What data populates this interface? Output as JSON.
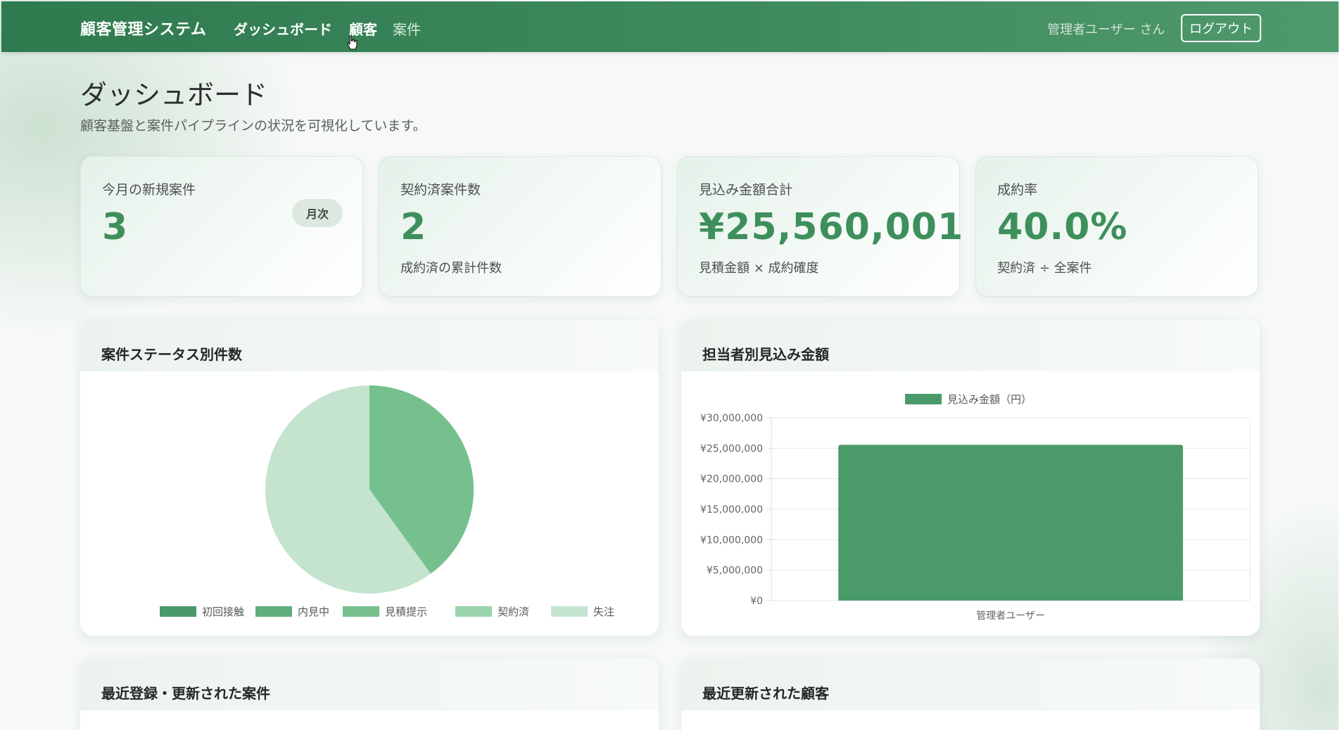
{
  "nav": {
    "brand": "顧客管理システム",
    "links": [
      "ダッシュボード",
      "顧客",
      "案件"
    ],
    "user": "管理者ユーザー さん",
    "logout": "ログアウト"
  },
  "header": {
    "title": "ダッシュボード",
    "subtitle": "顧客基盤と案件パイプラインの状況を可視化しています。"
  },
  "stats": [
    {
      "label": "今月の新規案件",
      "value": "3",
      "badge": "月次",
      "note": ""
    },
    {
      "label": "契約済案件数",
      "value": "2",
      "note": "成約済の累計件数"
    },
    {
      "label": "見込み金額合計",
      "value": "¥25,560,001",
      "note": "見積金額 × 成約確度"
    },
    {
      "label": "成約率",
      "value": "40.0%",
      "note": "契約済 ÷ 全案件"
    }
  ],
  "panels": {
    "status_title": "案件ステータス別件数",
    "amount_title": "担当者別見込み金額",
    "recent_deals_title": "最近登録・更新された案件",
    "recent_customers_title": "最近更新された顧客"
  },
  "colors": {
    "accent": "#3e8f5c",
    "status": [
      "#4a9a6a",
      "#5fae7b",
      "#76c08e",
      "#9ad4ab",
      "#c4e4cf"
    ]
  },
  "chart_data": [
    {
      "type": "pie",
      "categories": [
        "初回接触",
        "内見中",
        "見積提示",
        "契約済",
        "失注"
      ],
      "values": [
        0,
        0,
        2,
        0,
        3
      ],
      "title": "案件ステータス別件数"
    },
    {
      "type": "bar",
      "categories": [
        "管理者ユーザー"
      ],
      "series": [
        {
          "name": "見込み金額（円）",
          "values": [
            25560001
          ]
        }
      ],
      "ylim": [
        0,
        30000000
      ],
      "yticks": [
        "¥0",
        "¥5,000,000",
        "¥10,000,000",
        "¥15,000,000",
        "¥20,000,000",
        "¥25,000,000",
        "¥30,000,000"
      ],
      "title": "担当者別見込み金額",
      "grid": true,
      "legend": "top"
    }
  ]
}
